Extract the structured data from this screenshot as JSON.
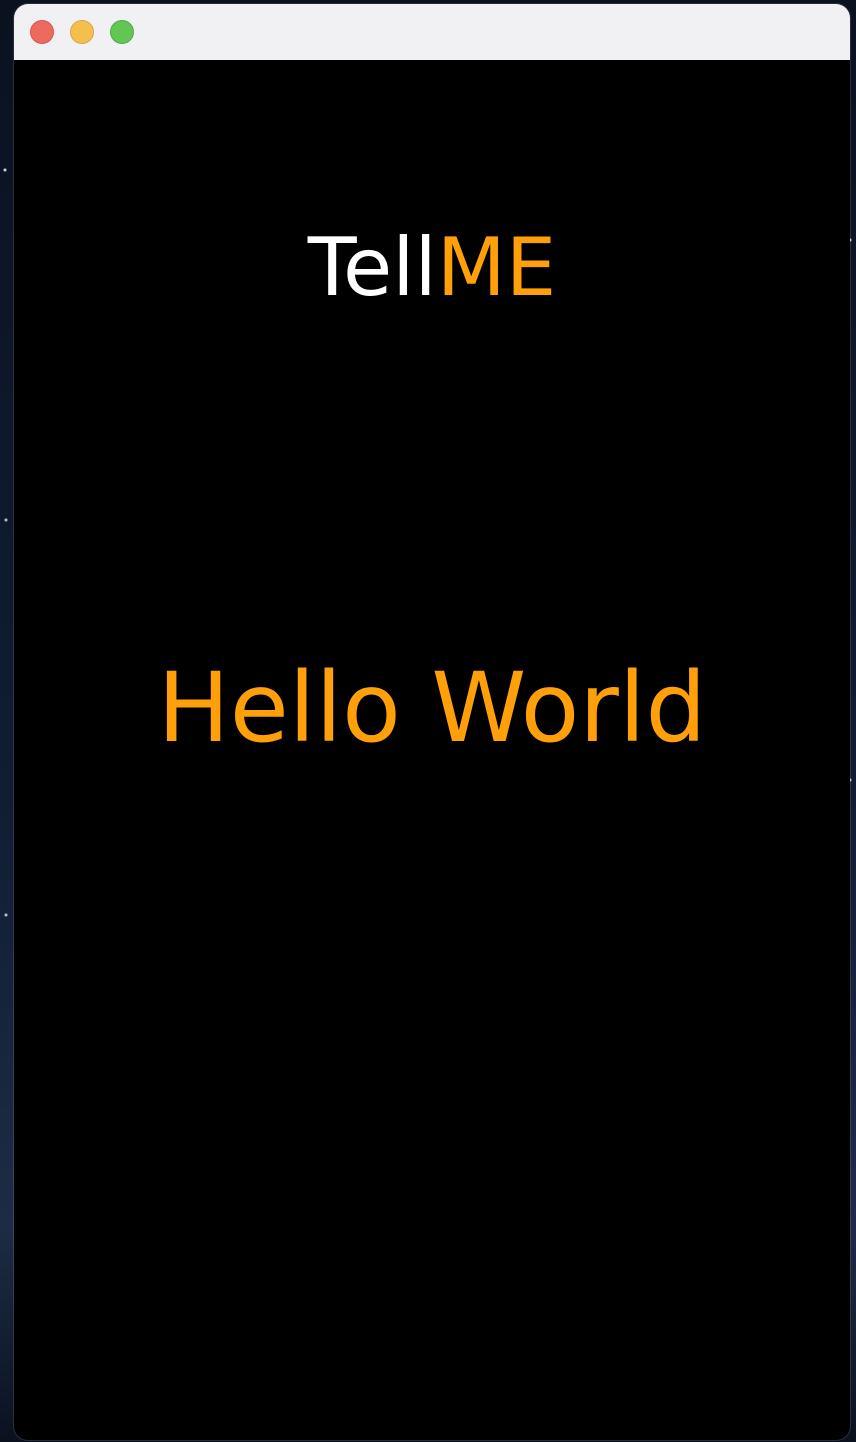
{
  "window": {
    "controls": {
      "close_icon": "close-icon",
      "minimize_icon": "minimize-icon",
      "zoom_icon": "zoom-icon"
    }
  },
  "app": {
    "logo_part_1": "Tell",
    "logo_part_2": "ME",
    "message": "Hello World"
  },
  "colors": {
    "background": "#000000",
    "logo_primary": "#ffffff",
    "accent": "#ff9f0a"
  }
}
